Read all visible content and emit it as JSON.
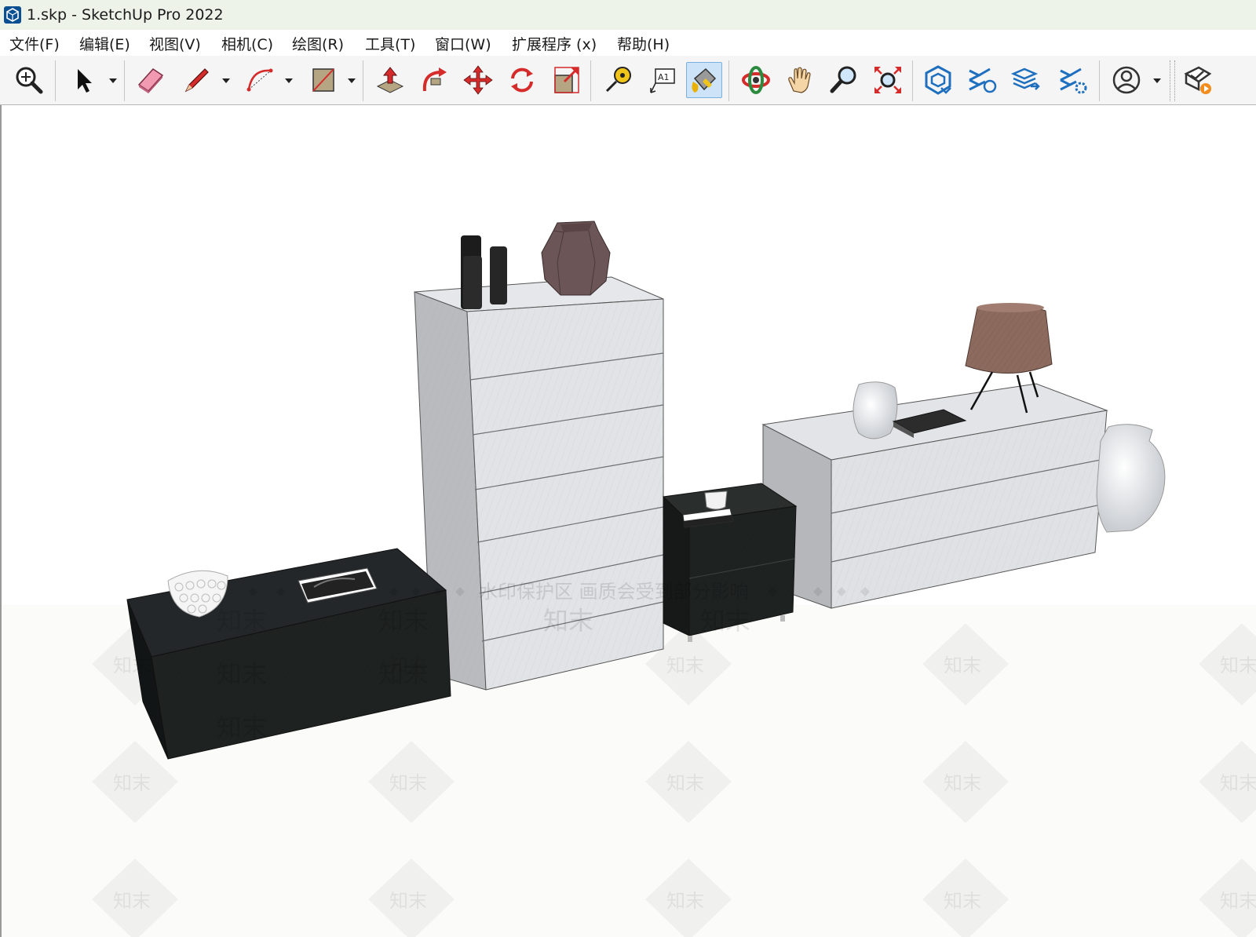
{
  "window": {
    "title": "1.skp - SketchUp Pro 2022",
    "app_icon": "sketchup-logo-icon"
  },
  "menu": {
    "items": [
      {
        "label": "文件(F)"
      },
      {
        "label": "编辑(E)"
      },
      {
        "label": "视图(V)"
      },
      {
        "label": "相机(C)"
      },
      {
        "label": "绘图(R)"
      },
      {
        "label": "工具(T)"
      },
      {
        "label": "窗口(W)"
      },
      {
        "label": "扩展程序 (x)"
      },
      {
        "label": "帮助(H)"
      }
    ]
  },
  "toolbar": {
    "tools": [
      {
        "name": "zoom-icon"
      },
      {
        "name": "select-arrow-icon"
      },
      {
        "name": "eraser-icon"
      },
      {
        "name": "pencil-line-icon"
      },
      {
        "name": "arc-icon"
      },
      {
        "name": "rectangle-icon"
      },
      {
        "name": "push-pull-icon"
      },
      {
        "name": "follow-me-icon"
      },
      {
        "name": "move-icon"
      },
      {
        "name": "rotate-icon"
      },
      {
        "name": "scale-icon"
      },
      {
        "name": "tape-measure-icon"
      },
      {
        "name": "text-label-icon",
        "text": "A1"
      },
      {
        "name": "paint-bucket-icon",
        "active": true
      },
      {
        "name": "orbit-icon"
      },
      {
        "name": "pan-hand-icon"
      },
      {
        "name": "zoom-magnifier-icon"
      },
      {
        "name": "zoom-extents-icon"
      },
      {
        "name": "3d-warehouse-icon"
      },
      {
        "name": "extension-warehouse-icon"
      },
      {
        "name": "layout-send-icon"
      },
      {
        "name": "extension-manager-icon"
      },
      {
        "name": "account-icon"
      },
      {
        "name": "trimble-connect-icon"
      }
    ]
  },
  "viewport": {
    "watermark_banner": "水印保护区 画质会受到部分影响",
    "watermark_logo": "知末",
    "colors": {
      "dark_cabinet": "#1e2221",
      "white_cabinet": "#e4e5e7",
      "vase_brown": "#6b5556",
      "lamp_shade": "#8c6a5e"
    }
  }
}
